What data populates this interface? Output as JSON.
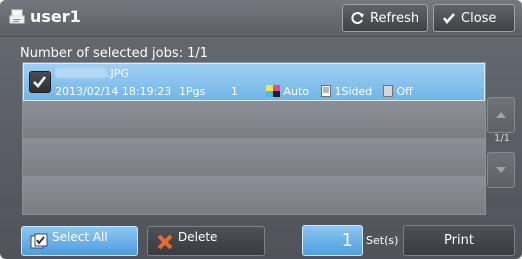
{
  "header": {
    "title": "user1",
    "refresh_label": "Refresh",
    "close_label": "Close"
  },
  "list": {
    "selected_text": "Number of selected jobs: 1/1",
    "rows": [
      {
        "filename_suffix": ".JPG",
        "datetime": "2013/02/14 18:19:23",
        "pages": "1Pgs",
        "copies": "1",
        "color": "Auto",
        "sides": "1Sided",
        "staple": "Off"
      }
    ]
  },
  "pagination": {
    "indicator": "1/1"
  },
  "bottom": {
    "select_all_label": "Select All",
    "delete_label": "Delete",
    "quantity": "1",
    "sets_label": "Set(s)",
    "print_label": "Print"
  },
  "colors": {
    "selected_row": "#86c2ef",
    "header_bg": "#666a70",
    "accent": "#4f9fe1"
  }
}
